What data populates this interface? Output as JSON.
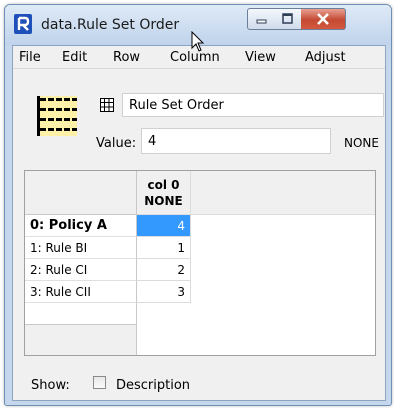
{
  "window": {
    "title": "data.Rule Set Order",
    "title_bar_color": "#c5d7ec"
  },
  "menu": {
    "items": [
      "File",
      "Edit",
      "Row",
      "Column",
      "View",
      "Adjust"
    ]
  },
  "slot": {
    "name": "Rule Set Order",
    "value_label": "Value:",
    "value": "4",
    "unit": "NONE"
  },
  "table": {
    "column": {
      "name": "col 0",
      "unit": "NONE"
    },
    "rows": [
      {
        "label": "0: Policy A",
        "value": "4",
        "selected": true
      },
      {
        "label": "1: Rule BI",
        "value": "1",
        "selected": false
      },
      {
        "label": "2: Rule CI",
        "value": "2",
        "selected": false
      },
      {
        "label": "3: Rule CII",
        "value": "3",
        "selected": false
      }
    ],
    "selection_color": "#3399ff"
  },
  "footer": {
    "show_label": "Show:",
    "description_label": "Description",
    "description_checked": false
  },
  "icons": {
    "app": "riverware-logo-icon",
    "series": "table-slot-icon",
    "small": "grid-icon"
  }
}
